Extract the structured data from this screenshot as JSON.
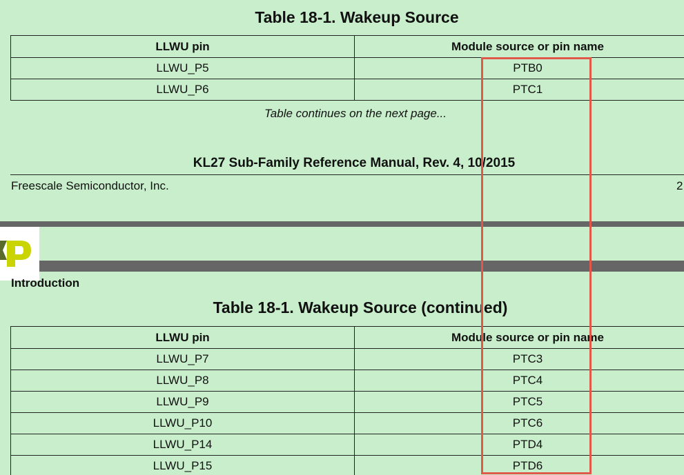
{
  "page1": {
    "table_title": "Table 18-1.   Wakeup Source",
    "columns": [
      "LLWU pin",
      "Module source or pin name"
    ],
    "rows": [
      [
        "LLWU_P5",
        "PTB0"
      ],
      [
        "LLWU_P6",
        "PTC1"
      ]
    ],
    "continues_note": "Table continues on the next page...",
    "footer_title": "KL27 Sub-Family Reference Manual, Rev. 4, 10/2015",
    "company": "Freescale Semiconductor, Inc.",
    "page_number_partial": "2"
  },
  "page2": {
    "section_label": "Introduction",
    "table_title": "Table 18-1.   Wakeup Source (continued)",
    "columns": [
      "LLWU pin",
      "Module source or pin name"
    ],
    "rows": [
      [
        "LLWU_P7",
        "PTC3"
      ],
      [
        "LLWU_P8",
        "PTC4"
      ],
      [
        "LLWU_P9",
        "PTC5"
      ],
      [
        "LLWU_P10",
        "PTC6"
      ],
      [
        "LLWU_P14",
        "PTD4"
      ],
      [
        "LLWU_P15",
        "PTD6"
      ]
    ]
  },
  "colors": {
    "page_background": "#c8eecb",
    "page_separator": "#666666",
    "highlight_box": "#e0584a",
    "logo_green": "#c9d400"
  }
}
